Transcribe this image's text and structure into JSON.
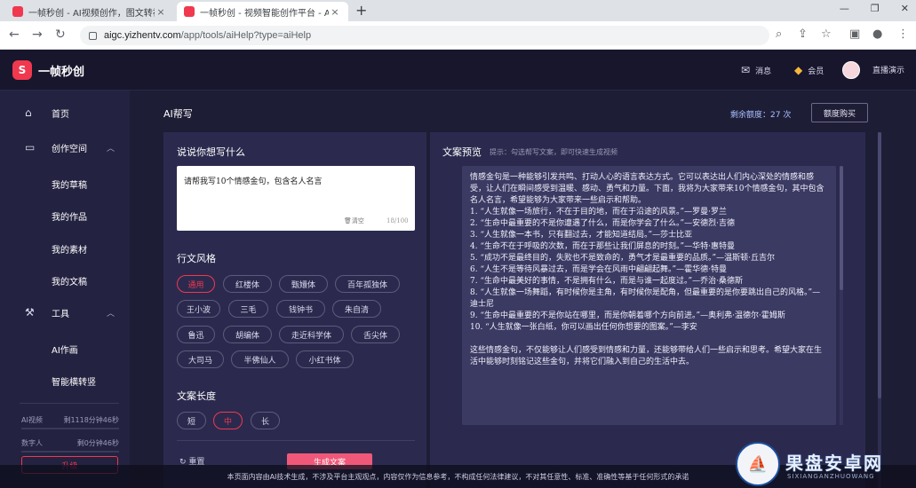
{
  "browser": {
    "tabs": [
      {
        "title": "一帧秒创 - AI视频创作，图文转视"
      },
      {
        "title": "一帧秒创 - 视频智能创作平台 - A"
      }
    ],
    "address": {
      "host": "aigc.yizhentv.com",
      "path": "/app/tools/aiHelp?type=aiHelp"
    },
    "icons": {
      "back": "←",
      "forward": "→",
      "reload": "↻",
      "new_tab": "+",
      "close": "×",
      "zoom": "zoom-icon",
      "share": "share-icon",
      "star": "star-icon",
      "sidepanel": "sidepanel-icon",
      "profile": "profile-icon",
      "menu": "menu-icon"
    }
  },
  "header": {
    "brand": "一帧秒创",
    "messages": "消息",
    "member": "会员",
    "live": "直播演示"
  },
  "sidebar": {
    "home": "首页",
    "create_space": "创作空间",
    "create_items": [
      "我的草稿",
      "我的作品",
      "我的素材",
      "我的文稿"
    ],
    "tools": "工具",
    "tool_items": [
      "AI作画",
      "智能横转竖"
    ],
    "quota": [
      {
        "label": "AI视频",
        "value": "剩1118分钟46秒"
      },
      {
        "label": "数字人",
        "value": "剩0分钟46秒"
      }
    ],
    "upgrade": "升级"
  },
  "main": {
    "title": "AI帮写",
    "remaining": "剩余额度：27 次",
    "buy": "额度购买"
  },
  "form": {
    "prompt_label": "说说你想写什么",
    "prompt_value": "请帮我写10个情感金句，包含名人名言",
    "clear": "清空",
    "count": "18/100",
    "style_label": "行文风格",
    "styles": [
      "通用",
      "红楼体",
      "甄嬛体",
      "百年孤独体",
      "王小波",
      "三毛",
      "钱钟书",
      "朱自清",
      "鲁迅",
      "胡编体",
      "走近科学体",
      "舌尖体",
      "大司马",
      "半佛仙人",
      "小红书体"
    ],
    "active_style": "通用",
    "length_label": "文案长度",
    "lengths": [
      "短",
      "中",
      "长"
    ],
    "active_length": "中",
    "reset": "重置",
    "generate": "生成文案"
  },
  "preview": {
    "title": "文案预览",
    "hint": "提示：勾选帮写文案，即可快速生成视频",
    "paragraphs": [
      "情感金句是一种能够引发共鸣、打动人心的语言表达方式。它可以表达出人们内心深处的情感和感受，让人们在瞬间感受到温暖、感动、勇气和力量。下面，我将为大家带来10个情感金句，其中包含名人名言，希望能够为大家带来一些启示和帮助。",
      "1. “人生就像一场旅行，不在于目的地，而在于沿途的风景。”—罗曼·罗兰",
      "2. “生命中最重要的不是你遭遇了什么，而是你学会了什么。”—安德烈·吉德",
      "3. “人生就像一本书，只有翻过去，才能知道结局。”—莎士比亚",
      "4. “生命不在于呼吸的次数，而在于那些让我们屏息的时刻。”—华特·惠特曼",
      "5. “成功不是最终目的，失败也不是致命的，勇气才是最重要的品质。”—温斯顿·丘吉尔",
      "6. “人生不是等待风暴过去，而是学会在风雨中翩翩起舞。”—霍华德·特曼",
      "7. “生命中最美好的事情，不是拥有什么，而是与谁一起度过。”—乔治·桑德斯",
      "8. “人生就像一场舞蹈，有时候你是主角，有时候你是配角，但最重要的是你要跳出自己的风格。”—迪士尼",
      "9. “生命中最重要的不是你站在哪里，而是你朝着哪个方向前进。”—奥利弗·温德尔·霍姆斯",
      "10. “人生就像一张白纸，你可以画出任何你想要的图案。”—李安",
      "",
      "这些情感金句，不仅能够让人们感受到情感和力量，还能够带给人们一些启示和思考。希望大家在生活中能够时刻铭记这些金句，并将它们融入到自己的生活中去。"
    ]
  },
  "disclaimer": "本页面内容由AI技术生成，不涉及平台主观观点，内容仅作为信息参考，不构成任何法律建议，不对其任意性、标准、准确性等基于任何形式的承诺",
  "watermark": {
    "text": "果盘安卓网",
    "sub": "SIXIANGANZHUOWANG"
  },
  "colors": {
    "accent": "#f0384f",
    "panel": "#2b2a4e",
    "header": "#17162c"
  }
}
